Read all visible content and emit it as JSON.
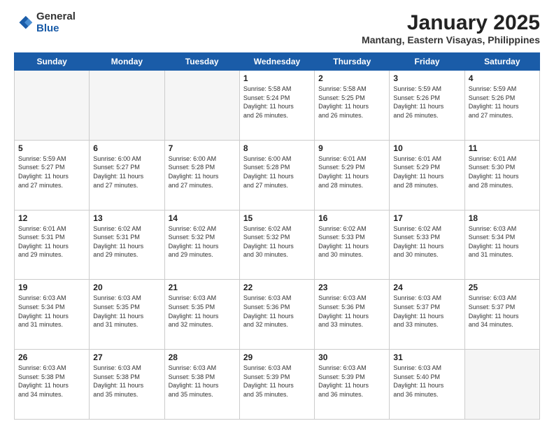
{
  "logo": {
    "general": "General",
    "blue": "Blue"
  },
  "title": "January 2025",
  "subtitle": "Mantang, Eastern Visayas, Philippines",
  "days": [
    "Sunday",
    "Monday",
    "Tuesday",
    "Wednesday",
    "Thursday",
    "Friday",
    "Saturday"
  ],
  "weeks": [
    [
      {
        "day": "",
        "info": ""
      },
      {
        "day": "",
        "info": ""
      },
      {
        "day": "",
        "info": ""
      },
      {
        "day": "1",
        "info": "Sunrise: 5:58 AM\nSunset: 5:24 PM\nDaylight: 11 hours\nand 26 minutes."
      },
      {
        "day": "2",
        "info": "Sunrise: 5:58 AM\nSunset: 5:25 PM\nDaylight: 11 hours\nand 26 minutes."
      },
      {
        "day": "3",
        "info": "Sunrise: 5:59 AM\nSunset: 5:26 PM\nDaylight: 11 hours\nand 26 minutes."
      },
      {
        "day": "4",
        "info": "Sunrise: 5:59 AM\nSunset: 5:26 PM\nDaylight: 11 hours\nand 27 minutes."
      }
    ],
    [
      {
        "day": "5",
        "info": "Sunrise: 5:59 AM\nSunset: 5:27 PM\nDaylight: 11 hours\nand 27 minutes."
      },
      {
        "day": "6",
        "info": "Sunrise: 6:00 AM\nSunset: 5:27 PM\nDaylight: 11 hours\nand 27 minutes."
      },
      {
        "day": "7",
        "info": "Sunrise: 6:00 AM\nSunset: 5:28 PM\nDaylight: 11 hours\nand 27 minutes."
      },
      {
        "day": "8",
        "info": "Sunrise: 6:00 AM\nSunset: 5:28 PM\nDaylight: 11 hours\nand 27 minutes."
      },
      {
        "day": "9",
        "info": "Sunrise: 6:01 AM\nSunset: 5:29 PM\nDaylight: 11 hours\nand 28 minutes."
      },
      {
        "day": "10",
        "info": "Sunrise: 6:01 AM\nSunset: 5:29 PM\nDaylight: 11 hours\nand 28 minutes."
      },
      {
        "day": "11",
        "info": "Sunrise: 6:01 AM\nSunset: 5:30 PM\nDaylight: 11 hours\nand 28 minutes."
      }
    ],
    [
      {
        "day": "12",
        "info": "Sunrise: 6:01 AM\nSunset: 5:31 PM\nDaylight: 11 hours\nand 29 minutes."
      },
      {
        "day": "13",
        "info": "Sunrise: 6:02 AM\nSunset: 5:31 PM\nDaylight: 11 hours\nand 29 minutes."
      },
      {
        "day": "14",
        "info": "Sunrise: 6:02 AM\nSunset: 5:32 PM\nDaylight: 11 hours\nand 29 minutes."
      },
      {
        "day": "15",
        "info": "Sunrise: 6:02 AM\nSunset: 5:32 PM\nDaylight: 11 hours\nand 30 minutes."
      },
      {
        "day": "16",
        "info": "Sunrise: 6:02 AM\nSunset: 5:33 PM\nDaylight: 11 hours\nand 30 minutes."
      },
      {
        "day": "17",
        "info": "Sunrise: 6:02 AM\nSunset: 5:33 PM\nDaylight: 11 hours\nand 30 minutes."
      },
      {
        "day": "18",
        "info": "Sunrise: 6:03 AM\nSunset: 5:34 PM\nDaylight: 11 hours\nand 31 minutes."
      }
    ],
    [
      {
        "day": "19",
        "info": "Sunrise: 6:03 AM\nSunset: 5:34 PM\nDaylight: 11 hours\nand 31 minutes."
      },
      {
        "day": "20",
        "info": "Sunrise: 6:03 AM\nSunset: 5:35 PM\nDaylight: 11 hours\nand 31 minutes."
      },
      {
        "day": "21",
        "info": "Sunrise: 6:03 AM\nSunset: 5:35 PM\nDaylight: 11 hours\nand 32 minutes."
      },
      {
        "day": "22",
        "info": "Sunrise: 6:03 AM\nSunset: 5:36 PM\nDaylight: 11 hours\nand 32 minutes."
      },
      {
        "day": "23",
        "info": "Sunrise: 6:03 AM\nSunset: 5:36 PM\nDaylight: 11 hours\nand 33 minutes."
      },
      {
        "day": "24",
        "info": "Sunrise: 6:03 AM\nSunset: 5:37 PM\nDaylight: 11 hours\nand 33 minutes."
      },
      {
        "day": "25",
        "info": "Sunrise: 6:03 AM\nSunset: 5:37 PM\nDaylight: 11 hours\nand 34 minutes."
      }
    ],
    [
      {
        "day": "26",
        "info": "Sunrise: 6:03 AM\nSunset: 5:38 PM\nDaylight: 11 hours\nand 34 minutes."
      },
      {
        "day": "27",
        "info": "Sunrise: 6:03 AM\nSunset: 5:38 PM\nDaylight: 11 hours\nand 35 minutes."
      },
      {
        "day": "28",
        "info": "Sunrise: 6:03 AM\nSunset: 5:38 PM\nDaylight: 11 hours\nand 35 minutes."
      },
      {
        "day": "29",
        "info": "Sunrise: 6:03 AM\nSunset: 5:39 PM\nDaylight: 11 hours\nand 35 minutes."
      },
      {
        "day": "30",
        "info": "Sunrise: 6:03 AM\nSunset: 5:39 PM\nDaylight: 11 hours\nand 36 minutes."
      },
      {
        "day": "31",
        "info": "Sunrise: 6:03 AM\nSunset: 5:40 PM\nDaylight: 11 hours\nand 36 minutes."
      },
      {
        "day": "",
        "info": ""
      }
    ]
  ]
}
